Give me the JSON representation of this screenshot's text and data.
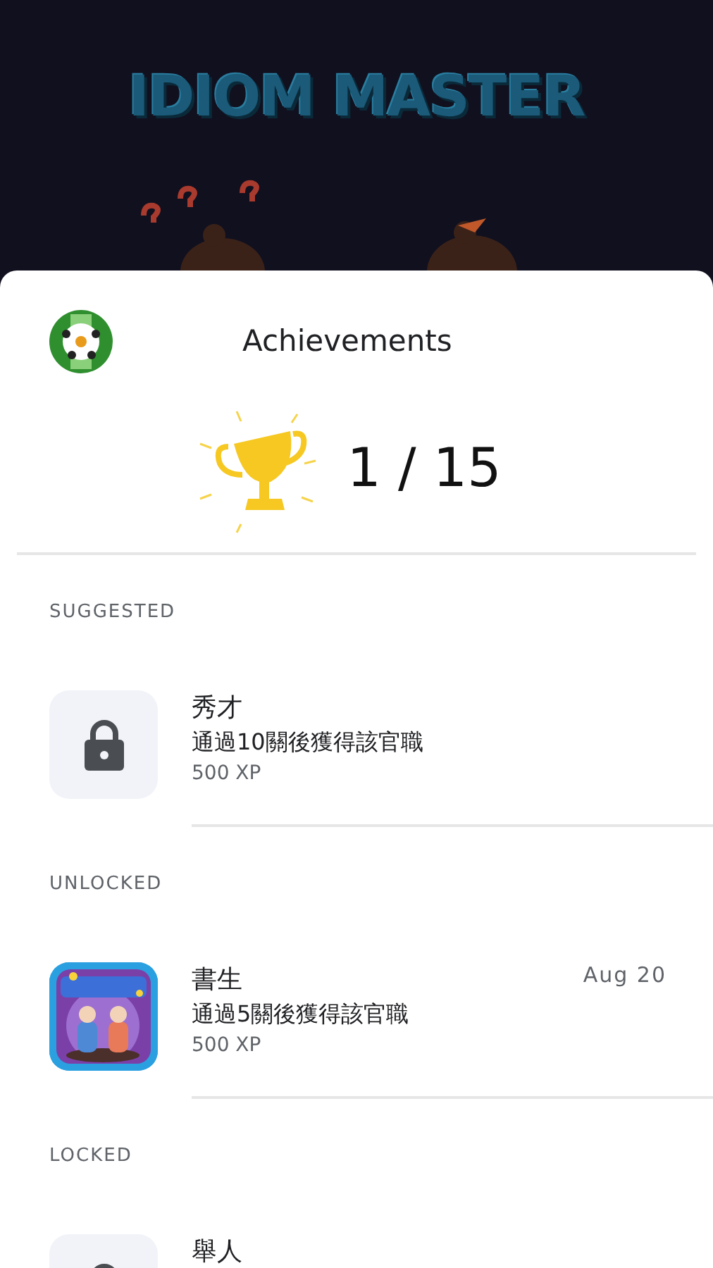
{
  "background": {
    "title": "IDIOM MASTER"
  },
  "sheet": {
    "title": "Achievements",
    "progress": "1 / 15"
  },
  "sections": [
    {
      "label": "SUGGESTED",
      "items": [
        {
          "kind": "locked",
          "title": "秀才",
          "description": "通過10關後獲得該官職",
          "xp": "500 XP"
        }
      ]
    },
    {
      "label": "UNLOCKED",
      "items": [
        {
          "kind": "unlocked",
          "title": "書生",
          "description": "通過5關後獲得該官職",
          "xp": "500 XP",
          "date": "Aug 20"
        }
      ]
    },
    {
      "label": "LOCKED",
      "items": [
        {
          "kind": "locked",
          "title": "舉人"
        }
      ]
    }
  ]
}
